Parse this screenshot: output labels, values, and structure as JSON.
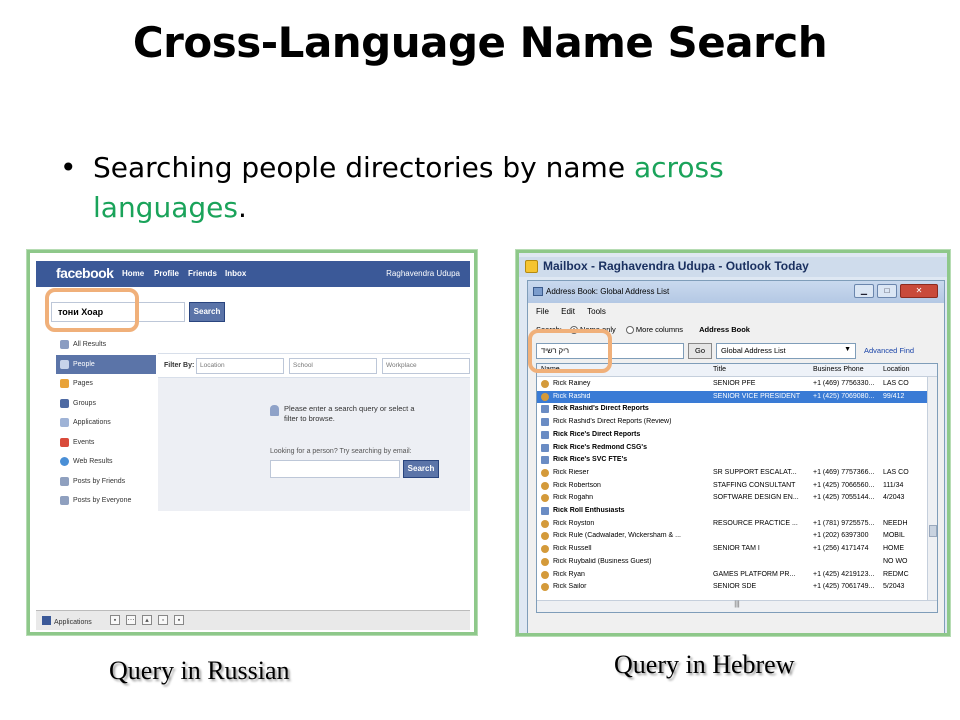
{
  "slide": {
    "title": "Cross-Language Name Search",
    "bullet_part1": "Searching people directories by name ",
    "bullet_highlight": "across languages",
    "bullet_end": ".",
    "highlight_color": "#1aa35a",
    "caption_left": "Query in Russian",
    "caption_right": "Query in Hebrew"
  },
  "facebook": {
    "logo": "facebook",
    "nav": [
      "Home",
      "Profile",
      "Friends",
      "Inbox"
    ],
    "user_name": "Raghavendra Udupa",
    "search_query": "тони Хоар",
    "search_button": "Search",
    "sidebar": [
      {
        "label": "All Results",
        "icon": "search-icon"
      },
      {
        "label": "People",
        "icon": "person-icon",
        "active": true
      },
      {
        "label": "Pages",
        "icon": "pages-icon"
      },
      {
        "label": "Groups",
        "icon": "groups-icon"
      },
      {
        "label": "Applications",
        "icon": "applications-icon"
      },
      {
        "label": "Events",
        "icon": "calendar-icon"
      },
      {
        "label": "Web Results",
        "icon": "globe-icon"
      },
      {
        "label": "Posts by Friends",
        "icon": "posts-icon"
      },
      {
        "label": "Posts by Everyone",
        "icon": "posts-icon"
      }
    ],
    "filter_label": "Filter By:",
    "filter_location": "Location",
    "filter_school": "School",
    "filter_workplace": "Workplace",
    "prompt_text": "Please enter a search query or select a filter to browse.",
    "email_label": "Looking for a person? Try searching by email:",
    "email_button": "Search",
    "bottom_app_label": "Applications"
  },
  "outlook": {
    "window_title": "Mailbox - Raghavendra Udupa - Outlook Today",
    "dialog_title": "Address Book: Global Address List",
    "menu": [
      "File",
      "Edit",
      "Tools"
    ],
    "search_label": "Search:",
    "name_only": "Name only",
    "more_columns": "More columns",
    "address_book_label": "Address Book",
    "query": "ריק רשיד",
    "go_button": "Go",
    "address_book_value": "Global Address List",
    "advanced_find": "Advanced Find",
    "columns": [
      "Name",
      "Title",
      "Business Phone",
      "Location"
    ],
    "rows": [
      {
        "name": "Rick Rainey",
        "title": "SENIOR PFE",
        "phone": "+1 (469) 7756330...",
        "location": "LAS CO",
        "type": "person"
      },
      {
        "name": "Rick Rashid",
        "title": "SENIOR VICE PRESIDENT",
        "phone": "+1 (425) 7069080...",
        "location": "99/412",
        "type": "person",
        "selected": true
      },
      {
        "name": "Rick Rashid's Direct Reports",
        "title": "",
        "phone": "",
        "location": "",
        "type": "group"
      },
      {
        "name": "Rick Rashid's Direct Reports (Review)",
        "title": "",
        "phone": "",
        "location": "",
        "type": "group-plain"
      },
      {
        "name": "Rick Rice's Direct Reports",
        "title": "",
        "phone": "",
        "location": "",
        "type": "group"
      },
      {
        "name": "Rick Rice's Redmond CSG's",
        "title": "",
        "phone": "",
        "location": "",
        "type": "group"
      },
      {
        "name": "Rick Rice's SVC FTE's",
        "title": "",
        "phone": "",
        "location": "",
        "type": "group"
      },
      {
        "name": "Rick Rieser",
        "title": "SR SUPPORT ESCALAT...",
        "phone": "+1 (469) 7757366...",
        "location": "LAS CO",
        "type": "person"
      },
      {
        "name": "Rick Robertson",
        "title": "STAFFING CONSULTANT",
        "phone": "+1 (425) 7066560...",
        "location": "111/34",
        "type": "person"
      },
      {
        "name": "Rick Rogahn",
        "title": "SOFTWARE DESIGN EN...",
        "phone": "+1 (425) 7055144...",
        "location": "4/2043",
        "type": "person"
      },
      {
        "name": "Rick Roll Enthusiasts",
        "title": "",
        "phone": "",
        "location": "",
        "type": "group"
      },
      {
        "name": "Rick Royston",
        "title": "RESOURCE PRACTICE ...",
        "phone": "+1 (781) 9725575...",
        "location": "NEEDH",
        "type": "person"
      },
      {
        "name": "Rick Rule (Cadwalader, Wickersham & ...",
        "title": "",
        "phone": "+1 (202) 6397300",
        "location": "MOBIL",
        "type": "person"
      },
      {
        "name": "Rick Russell",
        "title": "SENIOR TAM I",
        "phone": "+1 (256) 4171474",
        "location": "HOME",
        "type": "person"
      },
      {
        "name": "Rick Ruybalid (Business Guest)",
        "title": "",
        "phone": "",
        "location": "NO WO",
        "type": "person"
      },
      {
        "name": "Rick Ryan",
        "title": "GAMES PLATFORM PR...",
        "phone": "+1 (425) 4219123...",
        "location": "REDMC",
        "type": "person"
      },
      {
        "name": "Rick Sailor",
        "title": "SENIOR SDE",
        "phone": "+1 (425) 7061749...",
        "location": "5/2043",
        "type": "person"
      }
    ]
  }
}
